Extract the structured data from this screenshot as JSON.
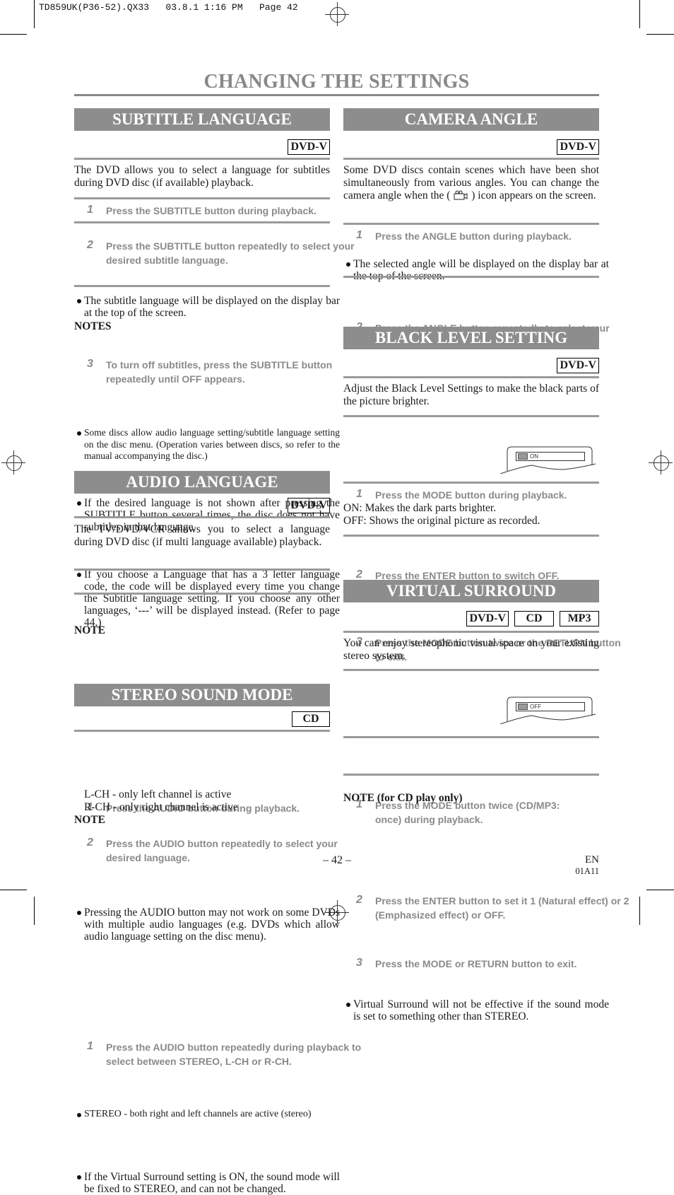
{
  "slug": "TD859UK(P36-52).QX33   03.8.1 1:16 PM   Page 42",
  "page_title": "CHANGING THE SETTINGS",
  "subtitle_language": {
    "title": "SUBTITLE LANGUAGE",
    "badges": [
      "DVD-V"
    ],
    "intro": "The DVD allows you to select a language for subtitles during DVD disc (if available) playback.",
    "steps": [
      {
        "num": "1",
        "text": "Press the SUBTITLE button during playback."
      },
      {
        "num": "2",
        "text": "Press the SUBTITLE button repeatedly to select your desired subtitle language."
      },
      {
        "num": "3",
        "text": "To turn off subtitles, press the SUBTITLE button repeatedly until OFF appears."
      }
    ],
    "step2_bullet": "The subtitle language will be displayed on the display bar at the top of the screen.",
    "notes_heading": "NOTES",
    "notes": [
      "Some discs allow audio language setting/subtitle language setting on the disc menu. (Operation varies between discs, so refer to the manual accompanying the disc.)",
      "If the desired language is not shown after pressing the SUBTITLE button several times, the disc does not have subtitles in that language.",
      "If you choose a Language that has a 3 letter language code, the code will be displayed every time you change the Subtitle language setting. If you choose any other languages, ‘---’ will be displayed instead. (Refer to page 44.)"
    ]
  },
  "audio_language": {
    "title": "AUDIO LANGUAGE",
    "badges": [
      "DVD-V"
    ],
    "intro": "The TV/DVD/VCR allows you to select a language during DVD disc (if multi language available) playback.",
    "steps": [
      {
        "num": "1",
        "text": "Press the AUDIO button during playback."
      },
      {
        "num": "2",
        "text": "Press the AUDIO button repeatedly to select your desired language."
      }
    ],
    "note_heading": "NOTE",
    "notes": [
      "Pressing the AUDIO button may not work on some DVDs with multiple audio languages (e.g. DVDs which allow audio language setting on the disc menu)."
    ]
  },
  "stereo_sound_mode": {
    "title": "STEREO SOUND MODE",
    "badges": [
      "CD"
    ],
    "steps": [
      {
        "num": "1",
        "text": "Press the AUDIO button repeatedly during playback to select between STEREO, L-CH or R-CH."
      }
    ],
    "bullet": "STEREO - both right and left channels are active (stereo)",
    "lines": [
      "L-CH - only left channel is active",
      "R-CH - only right channel is active"
    ],
    "note_heading": "NOTE",
    "notes": [
      "If the Virtual Surround setting is ON, the sound mode will be fixed to STEREO, and can not be changed."
    ]
  },
  "camera_angle": {
    "title": "CAMERA ANGLE",
    "badges": [
      "DVD-V"
    ],
    "intro_before_icon": "Some DVD discs contain scenes which have been shot simultaneously from various angles. You can change the camera angle when the (",
    "intro_icon": "camera-angle-icon",
    "intro_after_icon": ") icon appears on the screen.",
    "steps": [
      {
        "num": "1",
        "text": "Press the ANGLE button during playback."
      },
      {
        "num": "2",
        "text": "Press the ANGLE button repeatedly to select your desired angle."
      }
    ],
    "step1_bullet": "The selected angle will be displayed on the display bar at the top of the screen."
  },
  "black_level": {
    "title": "BLACK LEVEL SETTING",
    "badges": [
      "DVD-V"
    ],
    "intro": "Adjust the Black Level Settings to make the black parts of the picture brighter.",
    "steps": [
      {
        "num": "1",
        "text": "Press the MODE button during playback."
      },
      {
        "num": "2",
        "text": "Press the ENTER button to switch OFF."
      },
      {
        "num": "3",
        "text": "Press the MODE button twice or the RETURN button to exit."
      }
    ],
    "osd_value": "ON",
    "lines": [
      "ON: Makes the dark parts brighter.",
      "OFF: Shows the original picture as recorded."
    ]
  },
  "virtual_surround": {
    "title": "VIRTUAL SURROUND",
    "badges": [
      "DVD-V",
      "CD",
      "MP3"
    ],
    "intro": "You can enjoy stereophonic visual space on your existing stereo system.",
    "steps": [
      {
        "num": "1",
        "text": "Press the MODE button twice (CD/MP3: once) during playback."
      },
      {
        "num": "2",
        "text": "Press the ENTER button to set it 1 (Natural effect) or 2 (Emphasized effect) or OFF."
      },
      {
        "num": "3",
        "text": "Press the MODE or RETURN button to exit."
      }
    ],
    "osd_value": "OFF",
    "note_heading": "NOTE (for CD play only)",
    "notes": [
      "Virtual Surround will not be effective if the sound mode is set to something other than STEREO."
    ]
  },
  "footer": {
    "page_number": "– 42 –",
    "lang": "EN",
    "code": "01A11"
  }
}
